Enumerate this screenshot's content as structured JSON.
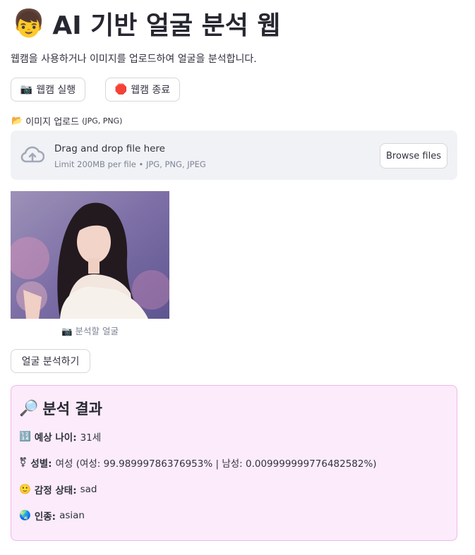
{
  "header": {
    "title_icon": "boy-face-icon",
    "title_emoji": "👦",
    "title": "AI 기반 얼굴 분석 웹",
    "subtitle": "웹캠을 사용하거나 이미지를 업로드하여 얼굴을 분석합니다."
  },
  "webcam": {
    "start_icon": "📷",
    "start_label": "웹캠 실행",
    "stop_icon": "🛑",
    "stop_label": "웹캠 종료"
  },
  "upload": {
    "label_icon": "📂",
    "label": "이미지 업로드",
    "label_hint": "(JPG, PNG)",
    "drop_text": "Drag and drop file here",
    "limit_text": "Limit 200MB per file • JPG, PNG, JPEG",
    "browse_label": "Browse files"
  },
  "image": {
    "caption_icon": "📷",
    "caption": "분석할 얼굴"
  },
  "analyze_button": "얼굴 분석하기",
  "result": {
    "heading_icon": "🔎",
    "heading": "분석 결과",
    "age_icon": "🔢",
    "age_label": "예상 나이:",
    "age_value": "31세",
    "gender_icon": "⚧",
    "gender_label": "성별:",
    "gender_value": "여성 (여성: 99.98999786376953% | 남성: 0.009999999776482582%)",
    "emotion_icon": "🙂",
    "emotion_label": "감정 상태:",
    "emotion_value": "sad",
    "race_icon": "🌏",
    "race_label": "인종:",
    "race_value": "asian"
  },
  "colors": {
    "accent_pink_bg": "#fcebfa",
    "accent_pink_border": "#f1b6ec",
    "dropzone_bg": "#f0f2f6"
  }
}
